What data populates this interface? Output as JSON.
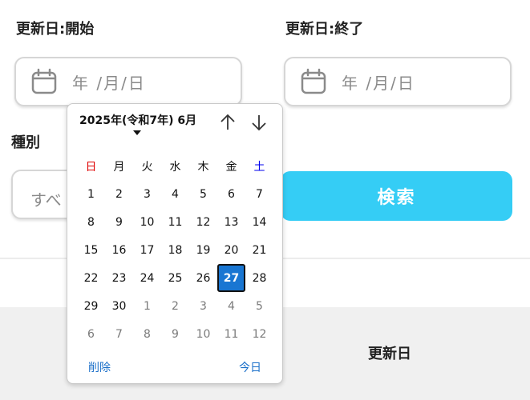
{
  "filters": {
    "start_label": "更新日:開始",
    "end_label": "更新日:終了",
    "date_placeholder": "年 /月/日",
    "kind_label": "種別",
    "kind_value": "すべ",
    "search_label": "検索"
  },
  "table": {
    "updated_header": "更新日"
  },
  "datepicker": {
    "month_label": "2025年(令和7年) 6月",
    "weekdays": [
      "日",
      "月",
      "火",
      "水",
      "木",
      "金",
      "土"
    ],
    "weeks": [
      [
        {
          "d": "1"
        },
        {
          "d": "2"
        },
        {
          "d": "3"
        },
        {
          "d": "4"
        },
        {
          "d": "5"
        },
        {
          "d": "6"
        },
        {
          "d": "7"
        }
      ],
      [
        {
          "d": "8"
        },
        {
          "d": "9"
        },
        {
          "d": "10"
        },
        {
          "d": "11"
        },
        {
          "d": "12"
        },
        {
          "d": "13"
        },
        {
          "d": "14"
        }
      ],
      [
        {
          "d": "15"
        },
        {
          "d": "16"
        },
        {
          "d": "17"
        },
        {
          "d": "18"
        },
        {
          "d": "19"
        },
        {
          "d": "20"
        },
        {
          "d": "21"
        }
      ],
      [
        {
          "d": "22"
        },
        {
          "d": "23"
        },
        {
          "d": "24"
        },
        {
          "d": "25"
        },
        {
          "d": "26"
        },
        {
          "d": "27",
          "selected": true
        },
        {
          "d": "28"
        }
      ],
      [
        {
          "d": "29"
        },
        {
          "d": "30"
        },
        {
          "d": "1",
          "other": true
        },
        {
          "d": "2",
          "other": true
        },
        {
          "d": "3",
          "other": true
        },
        {
          "d": "4",
          "other": true
        },
        {
          "d": "5",
          "other": true
        }
      ],
      [
        {
          "d": "6",
          "other": true
        },
        {
          "d": "7",
          "other": true
        },
        {
          "d": "8",
          "other": true
        },
        {
          "d": "9",
          "other": true
        },
        {
          "d": "10",
          "other": true
        },
        {
          "d": "11",
          "other": true
        },
        {
          "d": "12",
          "other": true
        }
      ]
    ],
    "clear_label": "削除",
    "today_label": "今日",
    "up_icon": "arrow-up-icon",
    "down_icon": "arrow-down-icon",
    "sunday_color": "#e00000",
    "saturday_color": "#0000ee",
    "selected_color": "#1976d2",
    "accent_color": "#35cdf5"
  }
}
